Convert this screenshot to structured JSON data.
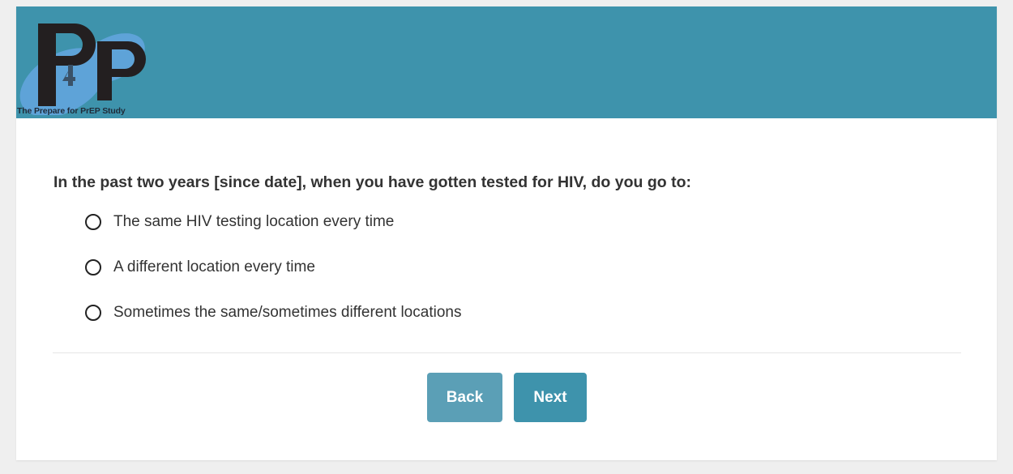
{
  "colors": {
    "header_bg": "#3e93ac",
    "back_button_bg": "#5b9fb6",
    "next_button_bg": "#3e93ac",
    "page_bg": "#efefef",
    "logo_shape": "#5ea3d8",
    "logo_letters": "#231f20"
  },
  "header": {
    "logo": {
      "big_letters": "P4P",
      "subtitle": "The Prepare for PrEP Study"
    }
  },
  "question": {
    "text": "In the past two years [since date], when you have gotten tested for HIV, do you go to:",
    "options": [
      {
        "label": "The same HIV testing location every time",
        "selected": false
      },
      {
        "label": "A different location every time",
        "selected": false
      },
      {
        "label": "Sometimes the same/sometimes different locations",
        "selected": false
      }
    ]
  },
  "navigation": {
    "back_label": "Back",
    "next_label": "Next"
  }
}
